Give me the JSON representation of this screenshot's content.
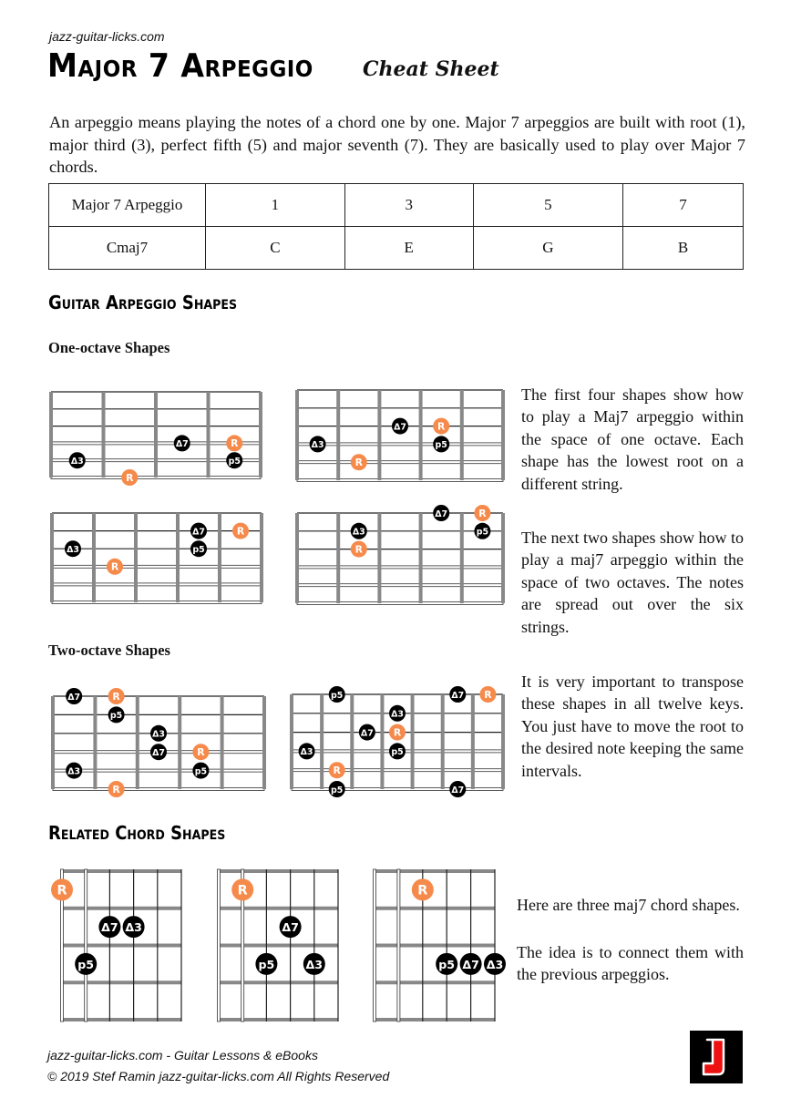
{
  "header": {
    "site": "jazz-guitar-licks.com",
    "title": "Major 7 Arpeggio",
    "subtitle": "Cheat Sheet"
  },
  "intro": "An arpeggio means playing the notes of a chord one by one. Major 7 arpeggios are built with root (1), major third (3), perfect fifth (5) and major seventh (7). They are basically used to play over Major 7 chords.",
  "interval_table": {
    "rows": [
      [
        "Major 7 Arpeggio",
        "1",
        "3",
        "5",
        "7"
      ],
      [
        "Cmaj7",
        "C",
        "E",
        "G",
        "B"
      ]
    ]
  },
  "sections": {
    "arpeggio_heading": "Guitar Arpeggio Shapes",
    "one_octave_heading": "One-octave Shapes",
    "two_octave_heading": "Two-octave Shapes",
    "chord_heading": "Related Chord Shapes"
  },
  "side_text": {
    "one_octave": "The first four shapes show how to play a Maj7 arpeggio within the space of one octave. Each shape has the lowest root on a different string.",
    "two_octave": "The next two shapes show how to play a maj7 arpeggio within the space of two octaves. The notes are spread out over the six strings.",
    "transpose": "It is very important to transpose these shapes in all twelve keys. You just have to move the root to the desired note keeping the same intervals.",
    "chords_1": "Here are three maj7 chord shapes.",
    "chords_2": "The idea is to connect them with the previous arpeggios."
  },
  "colors": {
    "root": "#f58a4b",
    "interval": "#000000",
    "fret": "#888888",
    "string": "#222222",
    "logo_bg": "#000000",
    "logo_letter": "#ee1111"
  },
  "arpeggio_diagrams": [
    {
      "name": "one-octave-shape-1",
      "frets": 4,
      "notes": [
        {
          "string": 4,
          "fret": 2.5,
          "label": "Δ7",
          "type": "interval"
        },
        {
          "string": 4,
          "fret": 3.5,
          "label": "R",
          "type": "root"
        },
        {
          "string": 5,
          "fret": 0.5,
          "label": "Δ3",
          "type": "interval"
        },
        {
          "string": 5,
          "fret": 3.5,
          "label": "p5",
          "type": "interval"
        },
        {
          "string": 6,
          "fret": 1.5,
          "label": "R",
          "type": "root"
        }
      ]
    },
    {
      "name": "one-octave-shape-2",
      "frets": 5,
      "notes": [
        {
          "string": 3,
          "fret": 2.5,
          "label": "Δ7",
          "type": "interval"
        },
        {
          "string": 3,
          "fret": 3.5,
          "label": "R",
          "type": "root"
        },
        {
          "string": 4,
          "fret": 0.5,
          "label": "Δ3",
          "type": "interval"
        },
        {
          "string": 4,
          "fret": 3.5,
          "label": "p5",
          "type": "interval"
        },
        {
          "string": 5,
          "fret": 1.5,
          "label": "R",
          "type": "root"
        }
      ]
    },
    {
      "name": "one-octave-shape-3",
      "frets": 5,
      "notes": [
        {
          "string": 2,
          "fret": 3.5,
          "label": "Δ7",
          "type": "interval"
        },
        {
          "string": 2,
          "fret": 4.5,
          "label": "R",
          "type": "root"
        },
        {
          "string": 3,
          "fret": 0.5,
          "label": "Δ3",
          "type": "interval"
        },
        {
          "string": 3,
          "fret": 3.5,
          "label": "p5",
          "type": "interval"
        },
        {
          "string": 4,
          "fret": 1.5,
          "label": "R",
          "type": "root"
        }
      ]
    },
    {
      "name": "one-octave-shape-4",
      "frets": 5,
      "notes": [
        {
          "string": 1,
          "fret": 3.5,
          "label": "Δ7",
          "type": "interval"
        },
        {
          "string": 1,
          "fret": 4.5,
          "label": "R",
          "type": "root"
        },
        {
          "string": 2,
          "fret": 1.5,
          "label": "Δ3",
          "type": "interval"
        },
        {
          "string": 2,
          "fret": 4.5,
          "label": "p5",
          "type": "interval"
        },
        {
          "string": 3,
          "fret": 1.5,
          "label": "R",
          "type": "root"
        }
      ]
    },
    {
      "name": "two-octave-shape-1",
      "frets": 5,
      "notes": [
        {
          "string": 1,
          "fret": 0.5,
          "label": "Δ7",
          "type": "interval"
        },
        {
          "string": 1,
          "fret": 1.5,
          "label": "R",
          "type": "root"
        },
        {
          "string": 2,
          "fret": 1.5,
          "label": "p5",
          "type": "interval"
        },
        {
          "string": 3,
          "fret": 2.5,
          "label": "Δ3",
          "type": "interval"
        },
        {
          "string": 4,
          "fret": 2.5,
          "label": "Δ7",
          "type": "interval"
        },
        {
          "string": 4,
          "fret": 3.5,
          "label": "R",
          "type": "root"
        },
        {
          "string": 5,
          "fret": 0.5,
          "label": "Δ3",
          "type": "interval"
        },
        {
          "string": 5,
          "fret": 3.5,
          "label": "p5",
          "type": "interval"
        },
        {
          "string": 6,
          "fret": 1.5,
          "label": "R",
          "type": "root"
        }
      ]
    },
    {
      "name": "two-octave-shape-2",
      "frets": 7,
      "notes": [
        {
          "string": 1,
          "fret": 1.5,
          "label": "p5",
          "type": "interval"
        },
        {
          "string": 1,
          "fret": 5.5,
          "label": "Δ7",
          "type": "interval"
        },
        {
          "string": 1,
          "fret": 6.5,
          "label": "R",
          "type": "root"
        },
        {
          "string": 2,
          "fret": 3.5,
          "label": "Δ3",
          "type": "interval"
        },
        {
          "string": 3,
          "fret": 2.5,
          "label": "Δ7",
          "type": "interval"
        },
        {
          "string": 3,
          "fret": 3.5,
          "label": "R",
          "type": "root"
        },
        {
          "string": 4,
          "fret": 0.5,
          "label": "Δ3",
          "type": "interval"
        },
        {
          "string": 4,
          "fret": 3.5,
          "label": "p5",
          "type": "interval"
        },
        {
          "string": 5,
          "fret": 1.5,
          "label": "R",
          "type": "root"
        },
        {
          "string": 6,
          "fret": 1.5,
          "label": "p5",
          "type": "interval"
        },
        {
          "string": 6,
          "fret": 5.5,
          "label": "Δ7",
          "type": "interval"
        }
      ]
    }
  ],
  "chord_diagrams": [
    {
      "name": "chord-shape-1",
      "notes": [
        {
          "string": 6,
          "fret": 1,
          "label": "R",
          "type": "root"
        },
        {
          "string": 4,
          "fret": 2,
          "label": "Δ7",
          "type": "interval"
        },
        {
          "string": 3,
          "fret": 2,
          "label": "Δ3",
          "type": "interval"
        },
        {
          "string": 5,
          "fret": 3,
          "label": "p5",
          "type": "interval"
        }
      ]
    },
    {
      "name": "chord-shape-2",
      "notes": [
        {
          "string": 5,
          "fret": 1,
          "label": "R",
          "type": "root"
        },
        {
          "string": 3,
          "fret": 2,
          "label": "Δ7",
          "type": "interval"
        },
        {
          "string": 4,
          "fret": 3,
          "label": "p5",
          "type": "interval"
        },
        {
          "string": 2,
          "fret": 3,
          "label": "Δ3",
          "type": "interval"
        }
      ]
    },
    {
      "name": "chord-shape-3",
      "notes": [
        {
          "string": 4,
          "fret": 1,
          "label": "R",
          "type": "root"
        },
        {
          "string": 3,
          "fret": 3,
          "label": "p5",
          "type": "interval"
        },
        {
          "string": 2,
          "fret": 3,
          "label": "Δ7",
          "type": "interval"
        },
        {
          "string": 1,
          "fret": 3,
          "label": "Δ3",
          "type": "interval"
        }
      ]
    }
  ],
  "footer": {
    "line1": "jazz-guitar-licks.com - Guitar Lessons & eBooks",
    "line2": "© 2019 Stef Ramin jazz-guitar-licks.com All Rights Reserved",
    "logo_letter": "J"
  }
}
